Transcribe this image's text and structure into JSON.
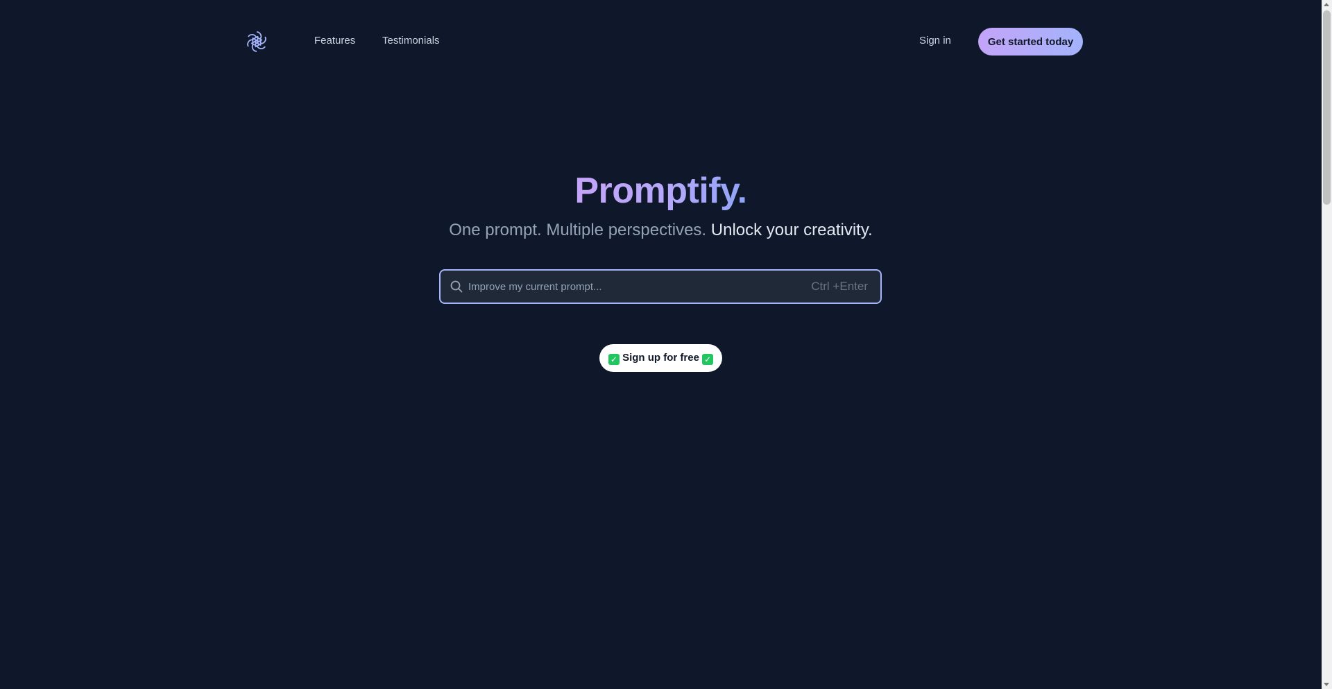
{
  "nav": {
    "logo_icon": "openai-knot-logo-icon",
    "links": [
      "Features",
      "Testimonials"
    ],
    "signin_label": "Sign in",
    "cta_label": "Get started today"
  },
  "hero": {
    "title": "Promptify.",
    "subtitle_muted": "One prompt. Multiple perspectives.",
    "subtitle_bright": "Unlock your creativity."
  },
  "search": {
    "icon": "search-icon",
    "placeholder": "Improve my current prompt...",
    "value": "",
    "shortcut": "Ctrl +Enter"
  },
  "signup": {
    "icon": "check-mark-icon",
    "label": "Sign up for free"
  },
  "colors": {
    "background": "#0f172a",
    "accent_start": "#c4a4f8",
    "accent_end": "#a3b3fb",
    "search_border": "#a5b4fc",
    "check_green": "#22c55e"
  }
}
